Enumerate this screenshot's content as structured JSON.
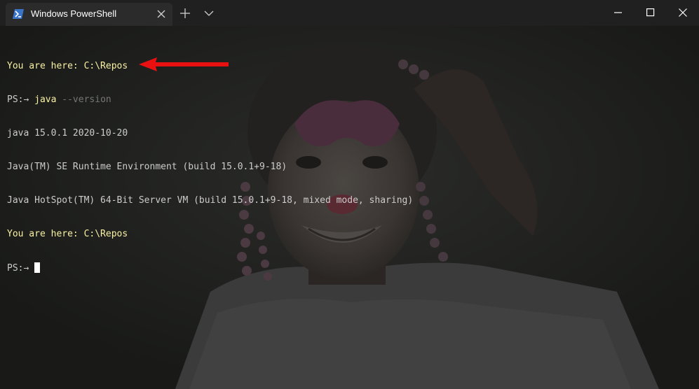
{
  "window": {
    "tab_title": "Windows PowerShell",
    "tab_icon": "powershell-icon",
    "new_tab_icon": "plus-icon",
    "dropdown_icon": "chevron-down-icon",
    "controls": [
      "minimize-icon",
      "maximize-icon",
      "close-icon"
    ]
  },
  "terminal": {
    "background_image": "face-painted child smiling (dimmed)",
    "prompt": "PS:→ ",
    "lines": {
      "l1": "You are here: C:\\Repos",
      "l2_cmd": "java",
      "l2_arg": " --version",
      "l3": "java 15.0.1 2020-10-20",
      "l4": "Java(TM) SE Runtime Environment (build 15.0.1+9-18)",
      "l5": "Java HotSpot(TM) 64-Bit Server VM (build 15.0.1+9-18, mixed mode, sharing)",
      "l6": "You are here: C:\\Repos"
    },
    "annotation": "red-arrow pointing at version line"
  },
  "colors": {
    "prompt_yellow": "#f9f1a5",
    "text_gray": "#cccccc",
    "arg_gray": "#767676",
    "arrow_red": "#e81010",
    "titlebar": "#202020",
    "tab": "#2b2b2b"
  }
}
